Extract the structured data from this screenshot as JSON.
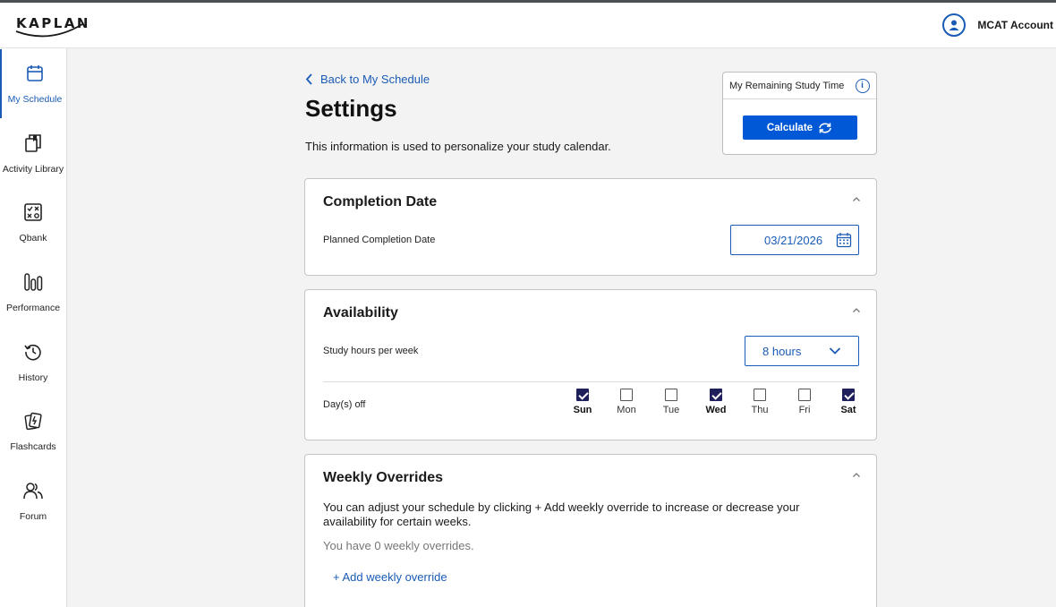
{
  "header": {
    "logo_text": "KAPLAN",
    "account_label": "MCAT Account",
    "icons": {
      "account": "user-circle-icon"
    }
  },
  "sidebar": {
    "items": [
      {
        "label": "My Schedule",
        "icon": "calendar-icon",
        "active": true
      },
      {
        "label": "Activity Library",
        "icon": "library-icon",
        "active": false
      },
      {
        "label": "Qbank",
        "icon": "qbank-icon",
        "active": false
      },
      {
        "label": "Performance",
        "icon": "bar-chart-icon",
        "active": false
      },
      {
        "label": "History",
        "icon": "history-icon",
        "active": false
      },
      {
        "label": "Flashcards",
        "icon": "flashcards-icon",
        "active": false
      },
      {
        "label": "Forum",
        "icon": "forum-icon",
        "active": false
      }
    ]
  },
  "main": {
    "back_link": "Back to My Schedule",
    "title": "Settings",
    "description": "This information is used to personalize your study calendar.",
    "study_time": {
      "title": "My Remaining Study Time",
      "button": "Calculate"
    },
    "completion": {
      "title": "Completion Date",
      "field_label": "Planned Completion Date",
      "value": "03/21/2026"
    },
    "availability": {
      "title": "Availability",
      "hours_label": "Study hours per week",
      "hours_value": "8 hours",
      "days_off_label": "Day(s) off",
      "days": [
        {
          "label": "Sun",
          "checked": true
        },
        {
          "label": "Mon",
          "checked": false
        },
        {
          "label": "Tue",
          "checked": false
        },
        {
          "label": "Wed",
          "checked": true
        },
        {
          "label": "Thu",
          "checked": false
        },
        {
          "label": "Fri",
          "checked": false
        },
        {
          "label": "Sat",
          "checked": true
        }
      ]
    },
    "overrides": {
      "title": "Weekly Overrides",
      "description": "You can adjust your schedule by clicking + Add weekly override to increase or decrease your availability for certain weeks.",
      "count_text": "You have 0 weekly overrides.",
      "add_link": "+ Add weekly override"
    }
  },
  "colors": {
    "accent": "#1a5bb5",
    "button": "#0058d6",
    "checkbox": "#1f1f5c"
  }
}
